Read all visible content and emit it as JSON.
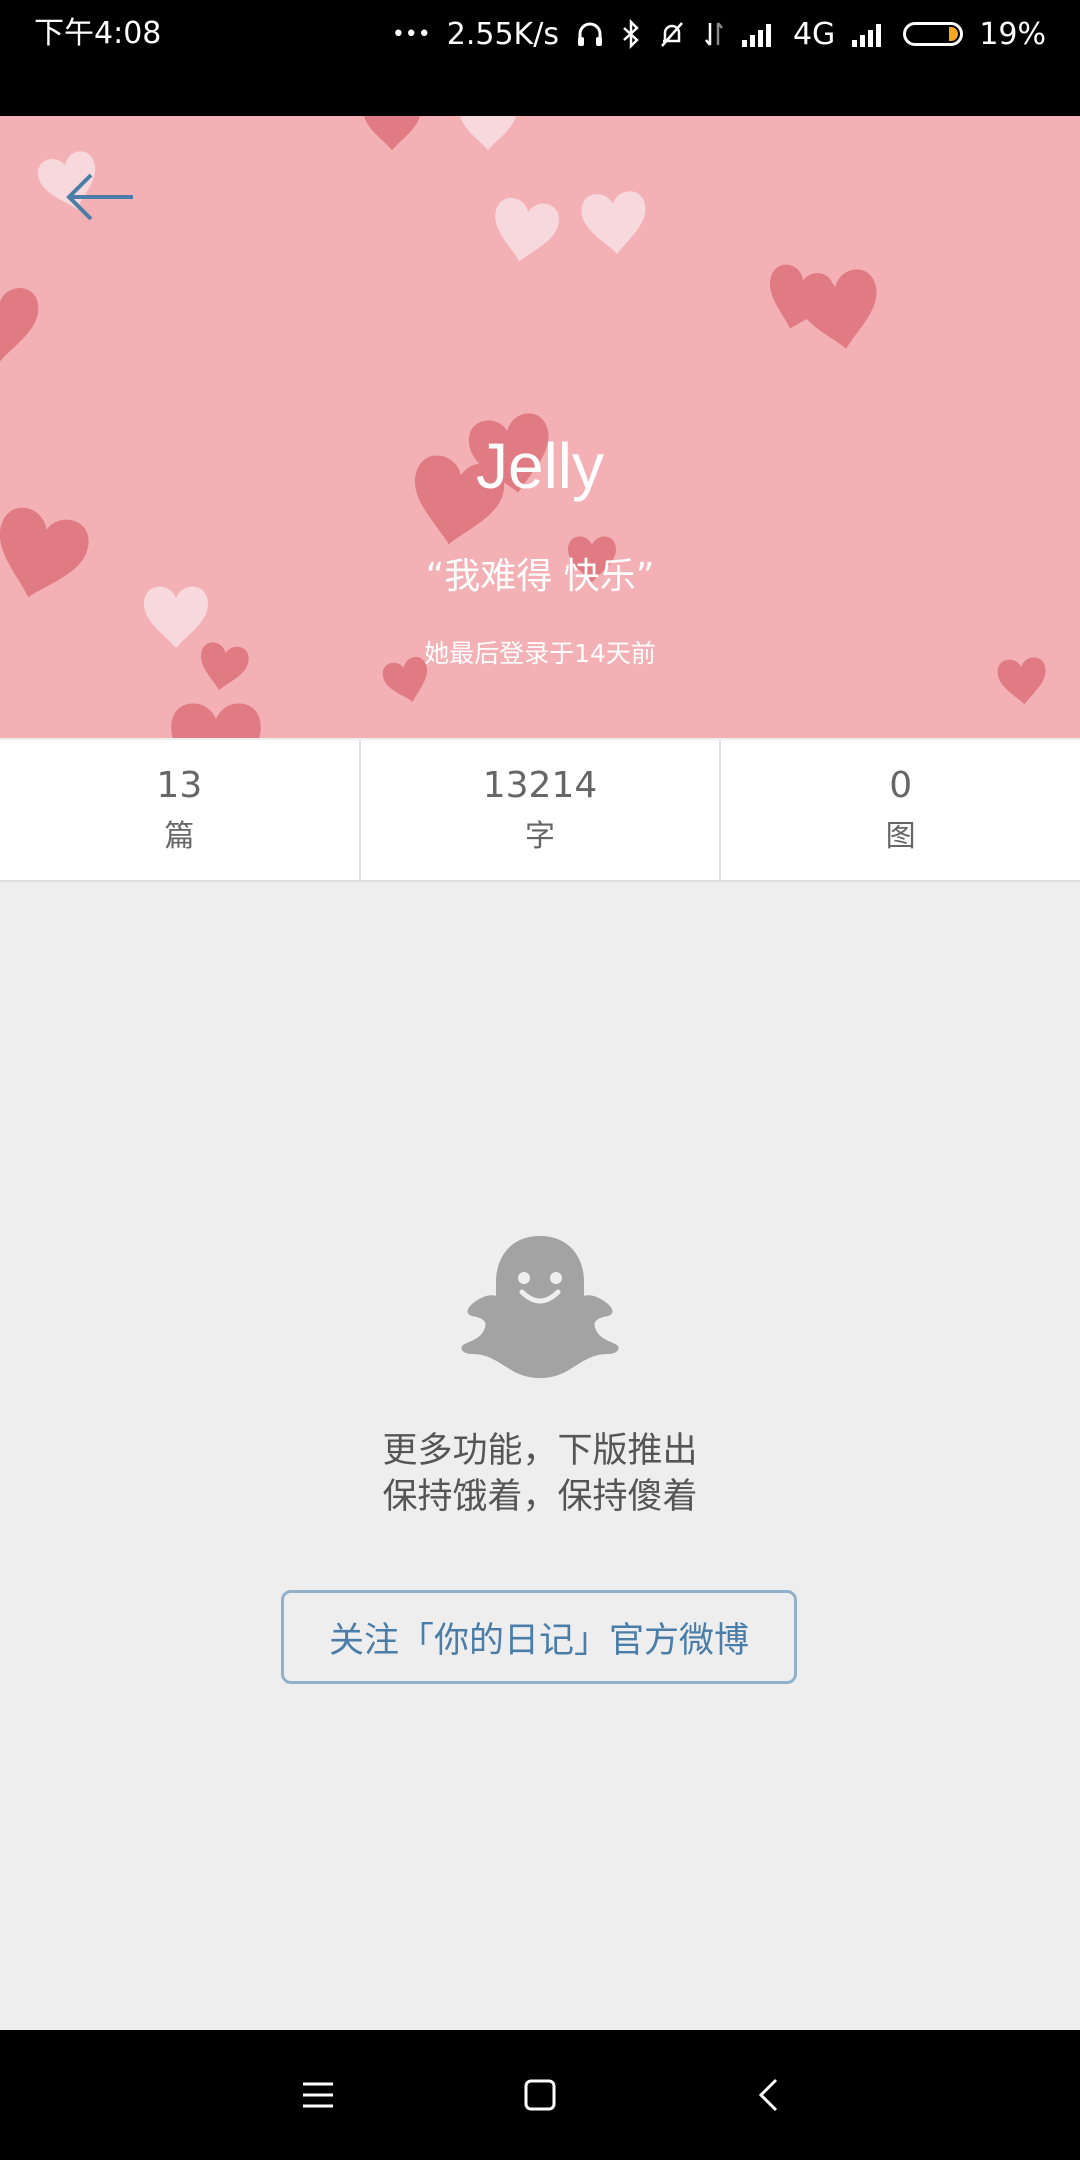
{
  "status_bar": {
    "time": "下午4:08",
    "dots": "•••",
    "network_speed": "2.55K/s",
    "network_type": "4G",
    "battery_percent": "19%",
    "battery_level": 0.19,
    "icons": [
      "headphones-icon",
      "bluetooth-icon",
      "mute-icon",
      "data-arrows-icon",
      "signal-icon",
      "signal-2-icon",
      "battery-icon"
    ]
  },
  "colors": {
    "header_bg": "#f3b1b6",
    "heart_dark": "#e07b84",
    "heart_light": "#f7d9dc",
    "accent_blue": "#4a7ea8",
    "ghost": "#a3a3a3"
  },
  "header": {
    "back_icon": "arrow-left-icon",
    "name": "Jelly",
    "quote": "“我难得 快乐”",
    "last_login": "她最后登录于14天前"
  },
  "stats": [
    {
      "value": "13",
      "label": "篇"
    },
    {
      "value": "13214",
      "label": "字"
    },
    {
      "value": "0",
      "label": "图"
    }
  ],
  "empty_state": {
    "icon": "ghost-icon",
    "line1": "更多功能，下版推出",
    "line2": "保持饿着，保持傻着",
    "button_label": "关注「你的日记」官方微博"
  },
  "nav_bar": {
    "icons": [
      "menu-icon",
      "home-icon",
      "back-icon"
    ]
  }
}
